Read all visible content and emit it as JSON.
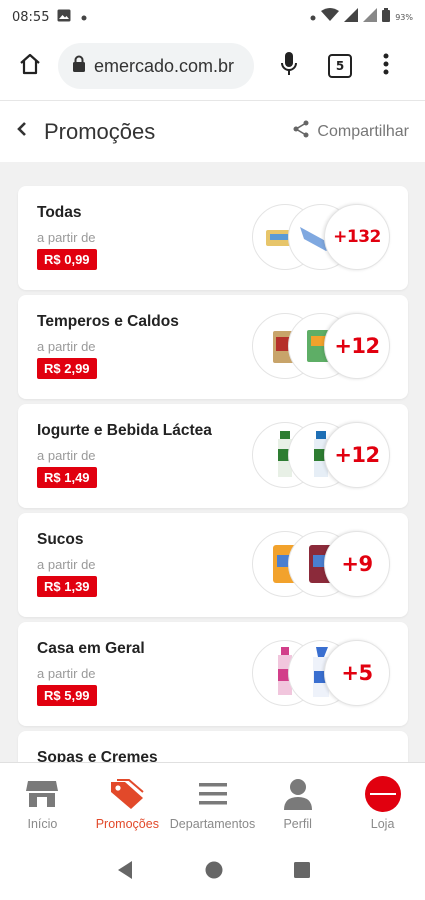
{
  "status_bar": {
    "time": "08:55",
    "battery": "93%"
  },
  "browser": {
    "url": "emercado.com.br",
    "tab_count": "5"
  },
  "header": {
    "title": "Promoções",
    "share_label": "Compartilhar"
  },
  "cards": [
    {
      "name": "Todas",
      "sub": "a partir de",
      "price": "R$ 0,99",
      "more": "+132"
    },
    {
      "name": "Temperos e Caldos",
      "sub": "a partir de",
      "price": "R$ 2,99",
      "more": "+12"
    },
    {
      "name": "Iogurte e Bebida Láctea",
      "sub": "a partir de",
      "price": "R$ 1,49",
      "more": "+12"
    },
    {
      "name": "Sucos",
      "sub": "a partir de",
      "price": "R$ 1,39",
      "more": "+9"
    },
    {
      "name": "Casa em Geral",
      "sub": "a partir de",
      "price": "R$ 5,99",
      "more": "+5"
    },
    {
      "name": "Sopas e Cremes",
      "sub": "",
      "price": "",
      "more": ""
    }
  ],
  "nav": [
    {
      "label": "Início",
      "icon": "store-icon"
    },
    {
      "label": "Promoções",
      "icon": "tag-icon",
      "active": true
    },
    {
      "label": "Departamentos",
      "icon": "menu-lines-icon"
    },
    {
      "label": "Perfil",
      "icon": "person-icon"
    },
    {
      "label": "Loja",
      "icon": "store-logo-icon"
    }
  ],
  "colors": {
    "accent": "#e1000f",
    "active_nav": "#e2492a"
  }
}
